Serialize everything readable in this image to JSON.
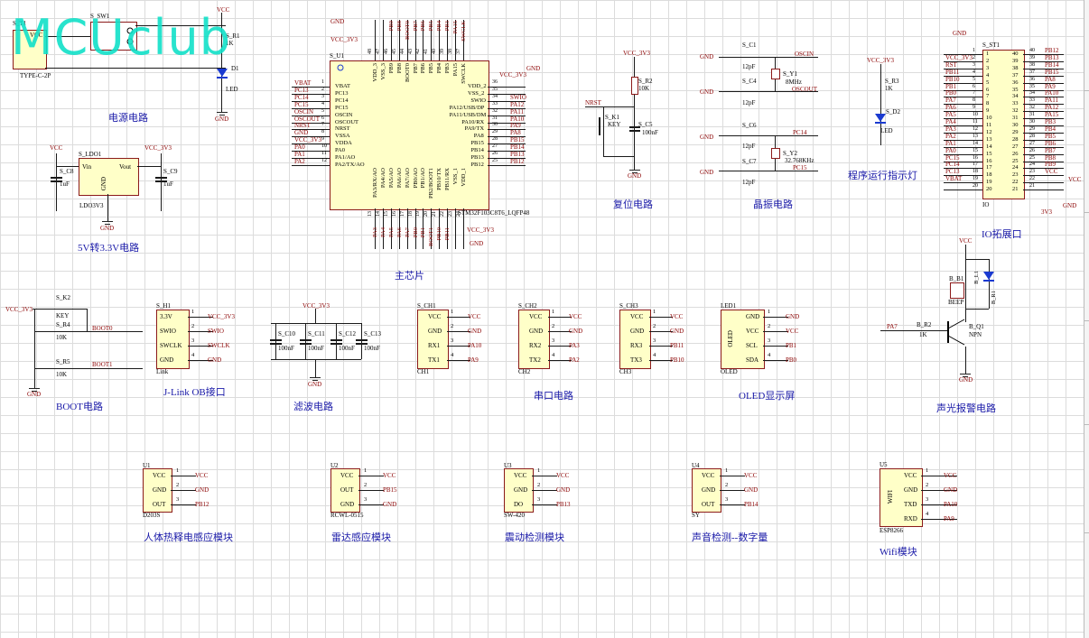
{
  "watermark": "MCUclub",
  "captions": {
    "power": "电源电路",
    "ldo": "5V转3.3V电路",
    "mcu": "主芯片",
    "reset": "复位电路",
    "crystal": "晶振电路",
    "led": "程序运行指示灯",
    "io": "IO拓展口",
    "boot": "BOOT电路",
    "jlink": "J-Link OB接口",
    "filter": "滤波电路",
    "uart": "串口电路",
    "oled": "OLED显示屏",
    "alarm": "声光报警电路",
    "pir": "人体热释电感应模块",
    "radar": "雷达感应模块",
    "vib": "震动检测模块",
    "sound": "声音检测--数字量",
    "wifi": "Wifi模块"
  },
  "designators": {
    "t1": "S_T1",
    "sw1": "S_SW1",
    "r1": "S_R1",
    "d1": "D1",
    "usb": "TYPE-C-2P",
    "ldo1": "S_LDO1",
    "c8": "S_C8",
    "c9": "S_C9",
    "ldo_part": "LDO3V3",
    "u1": "S_U1",
    "mcu_part": "STM32F103C8T6_LQFP48",
    "r2": "S_R2",
    "k1": "S_K1",
    "c5": "S_C5",
    "c1": "S_C1",
    "c4": "S_C4",
    "y1": "S_Y1",
    "c6": "S_C6",
    "c7": "S_C7",
    "y2": "S_Y2",
    "r3": "S_R3",
    "d2": "S_D2",
    "st1": "S_ST1",
    "io": "IO",
    "k2": "S_K2",
    "r4": "S_R4",
    "r5": "S_R5",
    "h1": "S_H1",
    "link": "Link",
    "c10": "S_C10",
    "c11": "S_C11",
    "c12": "S_C12",
    "c13": "S_C13",
    "ch1": "S_CH1",
    "ch2": "S_CH2",
    "ch3": "S_CH3",
    "led1": "LED1",
    "oled": "OLED",
    "b1": "B_B1",
    "beep": "BEEP",
    "b_r1": "B_R1",
    "b_l1": "B_L1",
    "b_r2": "B_R2",
    "b_q1": "B_Q1",
    "npn": "NPN",
    "u1m": "U1",
    "u2m": "U2",
    "u3m": "U3",
    "u4m": "U4",
    "u5m": "U5",
    "d203s": "D203S",
    "rcwl": "RCWL-0515",
    "sw420": "SW-420",
    "sy": "SY",
    "esp": "ESP8266"
  },
  "values": {
    "r1": "1K",
    "r2": "10K",
    "c5": "100nF",
    "c1": "12pF",
    "c4": "12pF",
    "y1": "8MHz",
    "c6": "12pF",
    "c7": "12pF",
    "y2": "32.768KHz",
    "r3": "1K",
    "c8": "1uF",
    "c9": "1uF",
    "r4": "10K",
    "r5": "10K",
    "key": "KEY",
    "b_r2": "1K",
    "b_r1": "1K",
    "cap100": "100nF",
    "led": "LED"
  },
  "nets": {
    "vcc": "VCC",
    "vcc33": "VCC_3V3",
    "gnd": "GND",
    "nrst": "NRST",
    "oscin": "OSCIN",
    "oscout": "OSCOUT",
    "pc14": "PC14",
    "pc15": "PC15",
    "boot0": "BOOT0",
    "boot1": "BOOT1",
    "swio": "SWIO",
    "swclk": "SWCLK",
    "pa10": "PA10",
    "pa9": "PA9",
    "pa3": "PA3",
    "pa2": "PA2",
    "pb11": "PB11",
    "pb10": "PB10",
    "pb1": "PB1",
    "pb0": "PB0",
    "pa7": "PA7",
    "pb12": "PB12",
    "pb15": "PB15",
    "pb13": "PB13",
    "pb14": "PB14",
    "v33": "3V3"
  },
  "ldo": {
    "vin": "Vin",
    "vout": "Vout",
    "gnd": "GND"
  },
  "mcu": {
    "left": [
      "VBAT",
      "PC13",
      "PC14",
      "PC15",
      "OSCIN",
      "OSCOUT",
      "NRST",
      "VSSA",
      "VDDA",
      "PA0",
      "PA1/AO",
      "PA2/TX/AO"
    ],
    "left_nets": [
      "VBAT",
      "PC13",
      "PC14",
      "PC15",
      "OSCIN",
      "OSCOUT",
      "NRST",
      "GND",
      "VCC_3V3",
      "PA0",
      "PA1",
      "PA2"
    ],
    "left_nums": [
      "1",
      "2",
      "3",
      "4",
      "5",
      "6",
      "7",
      "8",
      "9",
      "10",
      "11",
      "12"
    ],
    "right": [
      "VDD_2",
      "VSS_2",
      "SWIO",
      "PA12/USB/DP",
      "PA11/USB/DM",
      "PA10/RX",
      "PA9/TX",
      "PA8",
      "PB15",
      "PB14",
      "PB13",
      "PB12"
    ],
    "right_nets": [
      "",
      "",
      "SWIO",
      "PA12",
      "PA11",
      "PA10",
      "PA9",
      "PA8",
      "PB15",
      "PB14",
      "PB13",
      "PB12"
    ],
    "right_nums": [
      "36",
      "35",
      "34",
      "33",
      "32",
      "31",
      "30",
      "29",
      "28",
      "27",
      "26",
      "25"
    ],
    "top": [
      "VDD_3",
      "VSS_3",
      "PB9",
      "PB8",
      "BOOT0",
      "PB7",
      "PB6",
      "PB5",
      "PB4",
      "PB3",
      "PA15",
      "SWCLK"
    ],
    "top_nums": [
      "48",
      "47",
      "46",
      "45",
      "44",
      "43",
      "42",
      "41",
      "40",
      "39",
      "38",
      "37"
    ],
    "top_nets": [
      "",
      "",
      "PB9",
      "PB8",
      "BOOT0",
      "PB7",
      "PB6",
      "PB5",
      "PB4",
      "PB3",
      "PA15",
      "SWCLK"
    ],
    "bottom": [
      "PA3/RX/AO",
      "PA4/AO",
      "PA5/AO",
      "PA6/AO",
      "PA7/AO",
      "PB0/AO",
      "PB1/AO",
      "PB2/BOOT1",
      "PB10/TX",
      "PB11/RX",
      "VSS_1",
      "VDD_1"
    ],
    "bottom_nums": [
      "13",
      "14",
      "15",
      "16",
      "17",
      "18",
      "19",
      "20",
      "21",
      "22",
      "23",
      "24"
    ],
    "bottom_nets": [
      "PA3",
      "PA4",
      "PA5",
      "PA6",
      "PA7",
      "PB0",
      "PB1",
      "BOOT1",
      "PB10",
      "PB11",
      "",
      ""
    ]
  },
  "header40": {
    "left_nets": [
      "",
      "VCC_3V3",
      "RST",
      "PB11",
      "PB10",
      "PB1",
      "PB0",
      "PA7",
      "PA6",
      "PA5",
      "PA4",
      "PA3",
      "PA2",
      "PA1",
      "PA0",
      "PC15",
      "PC14",
      "PC13",
      "VBAT",
      ""
    ],
    "left_nums": [
      "1",
      "2",
      "3",
      "4",
      "5",
      "6",
      "7",
      "8",
      "9",
      "10",
      "11",
      "12",
      "13",
      "14",
      "15",
      "16",
      "17",
      "18",
      "19",
      "20"
    ],
    "right_nums": [
      "40",
      "39",
      "38",
      "37",
      "36",
      "35",
      "34",
      "33",
      "32",
      "31",
      "30",
      "29",
      "28",
      "27",
      "26",
      "25",
      "24",
      "23",
      "22",
      "21"
    ],
    "right_inner": [
      "40",
      "39",
      "38",
      "37",
      "36",
      "35",
      "34",
      "33",
      "32",
      "31",
      "30",
      "29",
      "28",
      "27",
      "26",
      "25",
      "24",
      "23",
      "22",
      "21"
    ],
    "right_nets": [
      "PB12",
      "PB13",
      "PB14",
      "PB15",
      "PA8",
      "PA9",
      "PA10",
      "PA11",
      "PA12",
      "PA15",
      "PB3",
      "PB4",
      "PB5",
      "PB6",
      "PB7",
      "PB8",
      "PB9",
      "VCC",
      "",
      ""
    ]
  },
  "jlink": {
    "pins": [
      "3.3V",
      "SWIO",
      "SWCLK",
      "GND"
    ],
    "nets": [
      "VCC_3V3",
      "SWIO",
      "SWCLK",
      "GND"
    ],
    "nums": [
      "1",
      "2",
      "3",
      "4"
    ]
  },
  "uart": [
    {
      "pins": [
        "VCC",
        "GND",
        "RX1",
        "TX1"
      ],
      "nets": [
        "VCC",
        "GND",
        "PA10",
        "PA9"
      ]
    },
    {
      "pins": [
        "VCC",
        "GND",
        "RX2",
        "TX2"
      ],
      "nets": [
        "VCC",
        "GND",
        "PA3",
        "PA2"
      ]
    },
    {
      "pins": [
        "VCC",
        "GND",
        "RX3",
        "TX3"
      ],
      "nets": [
        "VCC",
        "GND",
        "PB11",
        "PB10"
      ]
    }
  ],
  "uart_labels": [
    "CH1",
    "CH2",
    "CH3"
  ],
  "oledmod": {
    "pins": [
      "GND",
      "VCC",
      "SCL",
      "SDA"
    ],
    "nets": [
      "GND",
      "VCC",
      "PB1",
      "PB0"
    ],
    "nums": [
      "1",
      "2",
      "3",
      "4"
    ]
  },
  "modules": [
    {
      "pins": [
        "VCC",
        "GND",
        "OUT"
      ],
      "nets": [
        "VCC",
        "GND",
        "PB12"
      ]
    },
    {
      "pins": [
        "VCC",
        "OUT",
        "GND"
      ],
      "nets": [
        "VCC",
        "PB15",
        "GND"
      ]
    },
    {
      "pins": [
        "VCC",
        "GND",
        "DO"
      ],
      "nets": [
        "VCC",
        "GND",
        "PB13"
      ]
    },
    {
      "pins": [
        "VCC",
        "GND",
        "OUT"
      ],
      "nets": [
        "VCC",
        "GND",
        "PB14"
      ]
    }
  ],
  "wifi": {
    "pins": [
      "VCC",
      "GND",
      "TXD",
      "RXD"
    ],
    "nets": [
      "VCC",
      "GND",
      "PA10",
      "PA9"
    ],
    "inner": "WIFI"
  },
  "pn3": [
    "1",
    "2",
    "3"
  ],
  "pn4": [
    "1",
    "2",
    "3",
    "4"
  ]
}
